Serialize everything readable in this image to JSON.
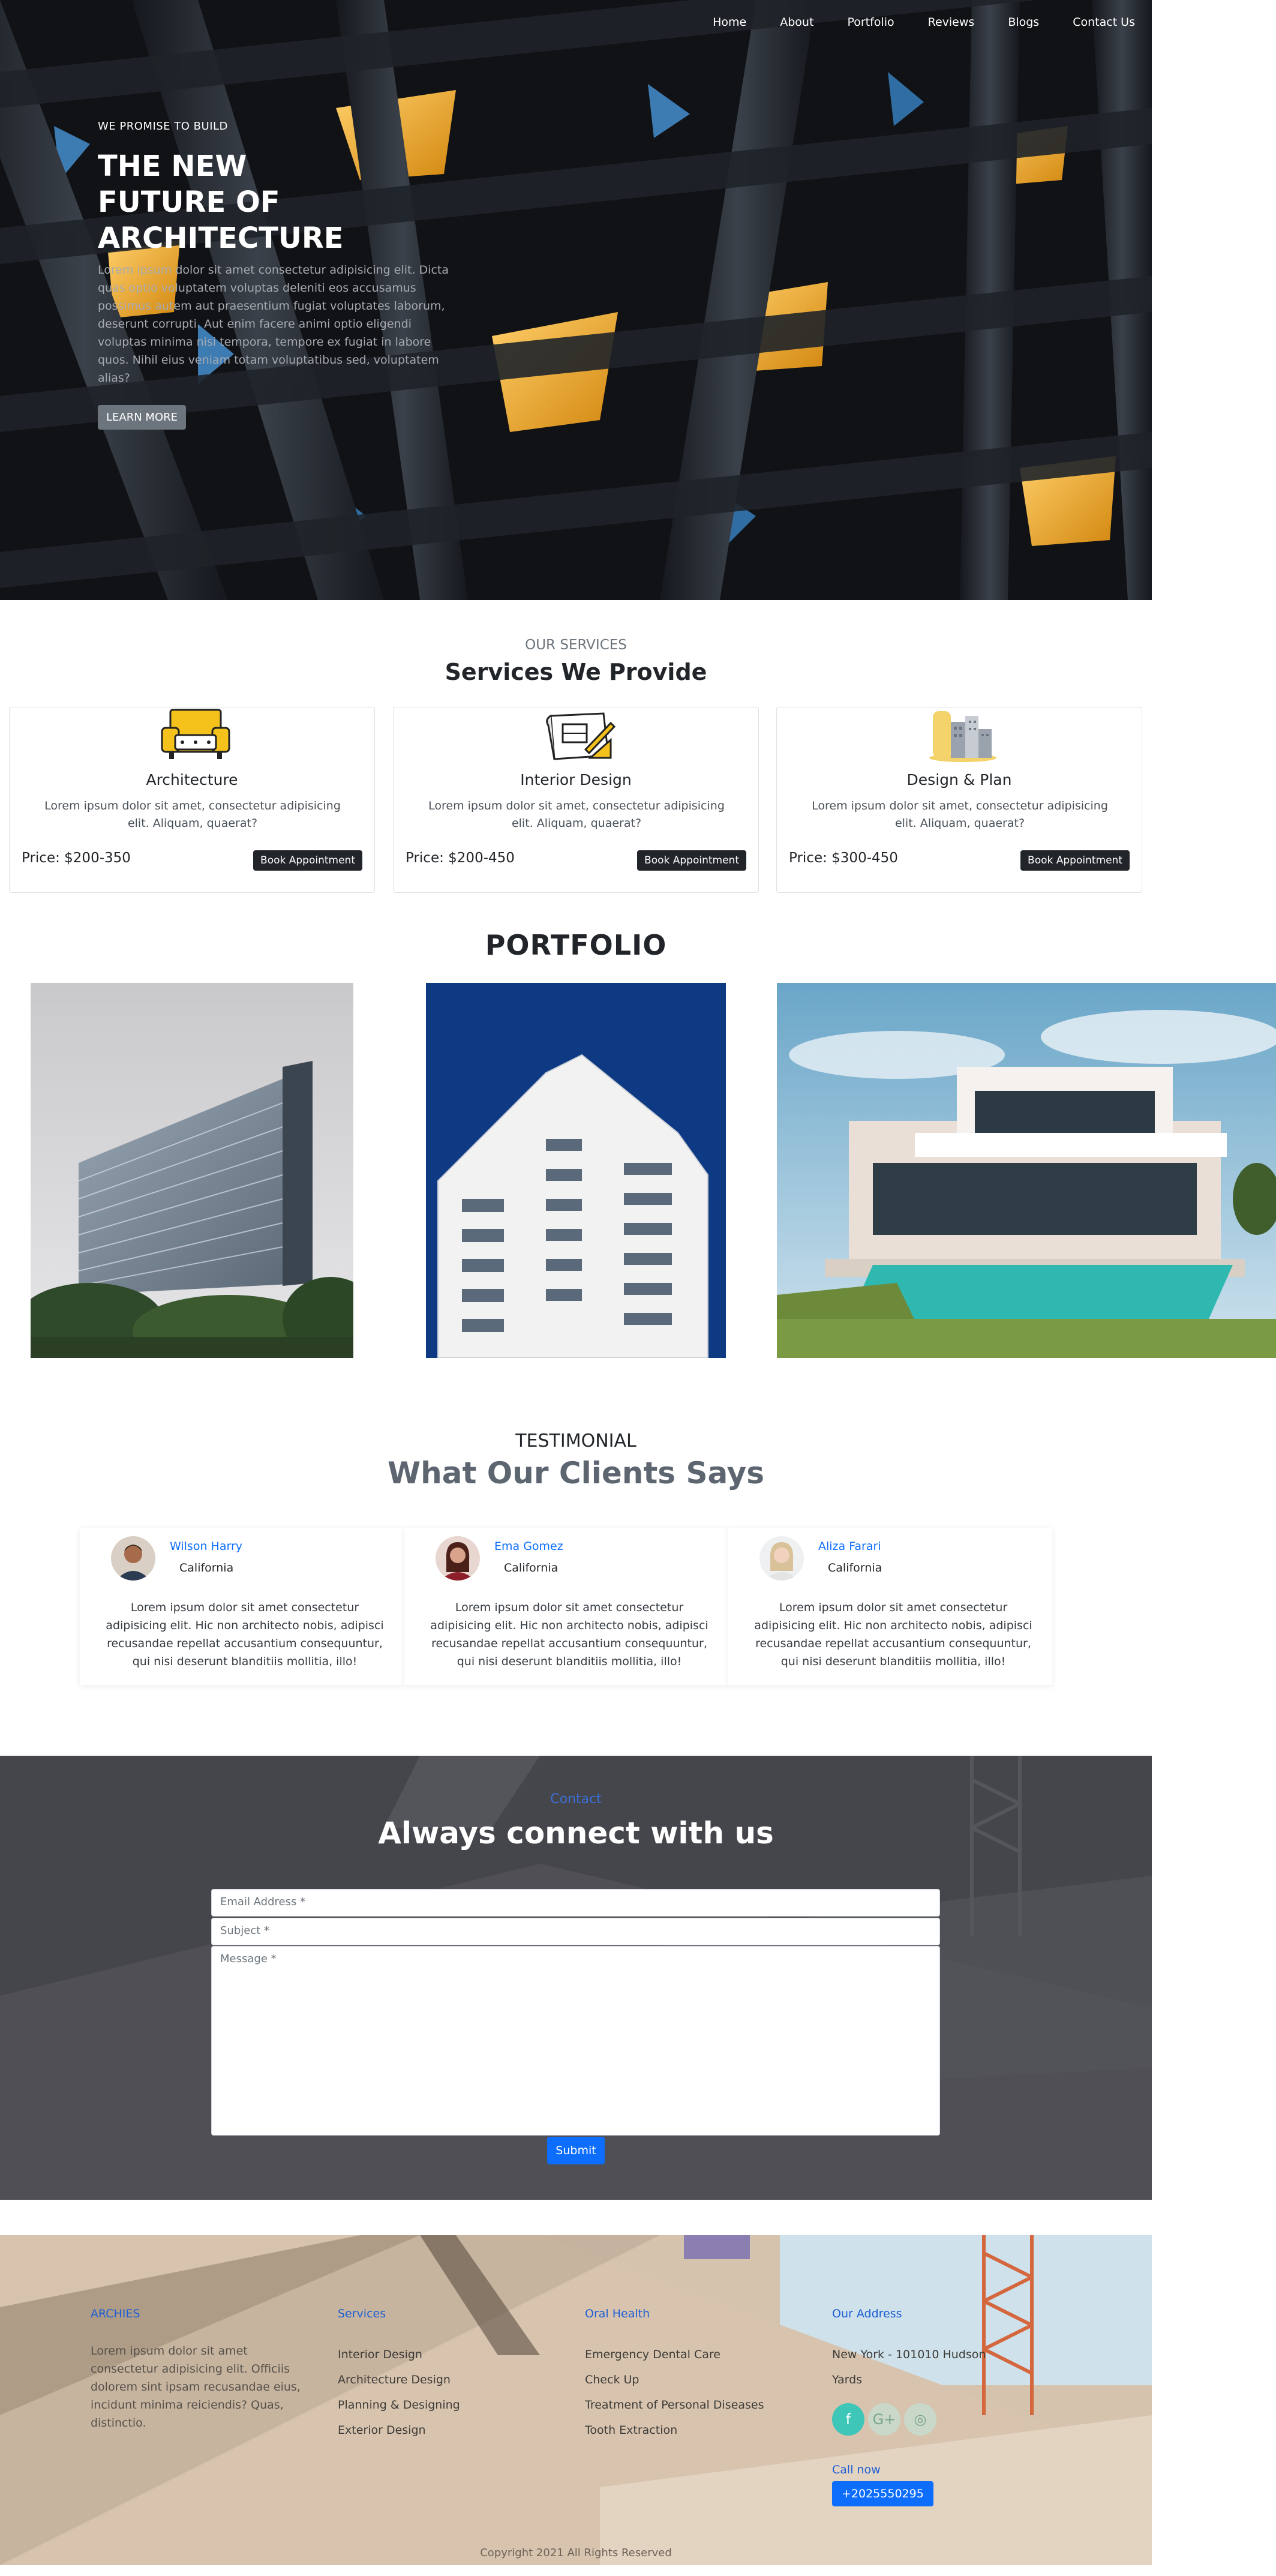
{
  "nav": {
    "items": [
      "Home",
      "About",
      "Portfolio",
      "Reviews",
      "Blogs",
      "Contact Us"
    ]
  },
  "hero": {
    "kicker": "WE PROMISE TO BUILD",
    "title_lines": [
      "THE NEW",
      "FUTURE OF",
      "ARCHITECTURE"
    ],
    "description": "Lorem ipsum dolor sit amet consectetur adipisicing elit. Dicta quas optio voluptatem voluptas deleniti eos accusamus possimus autem aut praesentium fugiat voluptates laborum, deserunt corrupti. Aut enim facere animi optio eligendi voluptas minima nisi tempora, tempore ex fugiat in labore quos. Nihil eius veniam totam voluptatibus sed, voluptatem alias?",
    "cta": "LEARN MORE"
  },
  "services": {
    "kicker": "OUR SERVICES",
    "title": "Services We Provide",
    "cards": [
      {
        "name": "Architecture",
        "desc": "Lorem ipsum dolor sit amet, consectetur adipisicing elit. Aliquam, quaerat?",
        "price": "Price: $200-350",
        "button": "Book Appointment",
        "icon": "sofa-icon"
      },
      {
        "name": "Interior Design",
        "desc": "Lorem ipsum dolor sit amet, consectetur adipisicing elit. Aliquam, quaerat?",
        "price": "Price: $200-450",
        "button": "Book Appointment",
        "icon": "blueprint-icon"
      },
      {
        "name": "Design & Plan",
        "desc": "Lorem ipsum dolor sit amet, consectetur adipisicing elit. Aliquam, quaerat?",
        "price": "Price: $300-450",
        "button": "Book Appointment",
        "icon": "buildings-icon"
      }
    ]
  },
  "portfolio": {
    "title": "PORTFOLIO"
  },
  "testimonial": {
    "kicker": "TESTIMONIAL",
    "title": "What Our Clients Says",
    "cards": [
      {
        "name": "Wilson Harry",
        "city": "California",
        "text": "Lorem ipsum dolor sit amet consectetur adipisicing elit. Hic non architecto nobis, adipisci recusandae repellat accusantium consequuntur, qui nisi deserunt blanditiis mollitia, illo!"
      },
      {
        "name": "Ema Gomez",
        "city": "California",
        "text": "Lorem ipsum dolor sit amet consectetur adipisicing elit. Hic non architecto nobis, adipisci recusandae repellat accusantium consequuntur, qui nisi deserunt blanditiis mollitia, illo!"
      },
      {
        "name": "Aliza Farari",
        "city": "California",
        "text": "Lorem ipsum dolor sit amet consectetur adipisicing elit. Hic non architecto nobis, adipisci recusandae repellat accusantium consequuntur, qui nisi deserunt blanditiis mollitia, illo!"
      }
    ]
  },
  "contact": {
    "kicker": "Contact",
    "title": "Always connect with us",
    "email_placeholder": "Email Address *",
    "subject_placeholder": "Subject *",
    "message_placeholder": "Message *",
    "submit": "Submit"
  },
  "footer": {
    "brand": "ARCHIES",
    "about": "Lorem ipsum dolor sit amet consectetur adipisicing elit. Officiis dolorem sint ipsam recusandae eius, incidunt minima reiciendis? Quas, distinctio.",
    "services_heading": "Services",
    "services_links": [
      "Interior Design",
      "Architecture Design",
      "Planning & Designing",
      "Exterior Design"
    ],
    "oral_heading": "Oral Health",
    "oral_links": [
      "Emergency Dental Care",
      "Check Up",
      "Treatment of Personal Diseases",
      "Tooth Extraction"
    ],
    "address_heading": "Our Address",
    "address_lines": [
      "New York - 101010 Hudson",
      "Yards"
    ],
    "social": [
      {
        "icon": "facebook-icon",
        "glyph": "f",
        "color": "#3ec6b8"
      },
      {
        "icon": "google-plus-icon",
        "glyph": "G+",
        "color": "#c9d8c8"
      },
      {
        "icon": "instagram-icon",
        "glyph": "◎",
        "color": "#c9d8c8"
      }
    ],
    "call_label": "Call now",
    "phone": "+2025550295",
    "copyright": "Copyright 2021 All Rights Reserved"
  }
}
